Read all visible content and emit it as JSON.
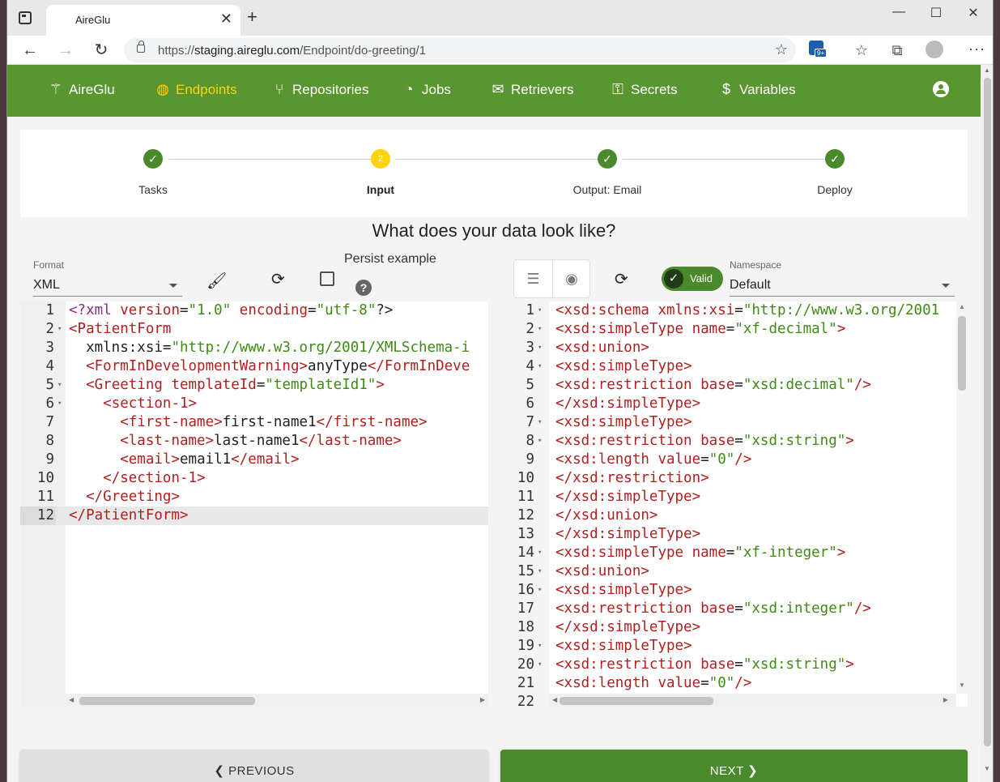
{
  "browser": {
    "tab_title": "AireGlu",
    "tab_close": "✕",
    "new_tab": "+",
    "minimize": "—",
    "maximize": "☐",
    "close": "✕",
    "url_prefix": "https://",
    "url_domain": "staging.aireglu.com",
    "url_path": "/Endpoint/do-greeting/1",
    "extension_badge": "9+"
  },
  "nav": {
    "brand": "AireGlu",
    "items": [
      {
        "label": "Endpoints",
        "icon": "globe-icon",
        "active": true
      },
      {
        "label": "Repositories",
        "icon": "branch-icon"
      },
      {
        "label": "Jobs",
        "icon": "clock-icon"
      },
      {
        "label": "Retrievers",
        "icon": "envelope-icon"
      },
      {
        "label": "Secrets",
        "icon": "key-icon"
      },
      {
        "label": "Variables",
        "icon": "dollar-icon"
      }
    ]
  },
  "stepper": {
    "steps": [
      {
        "label": "Tasks",
        "state": "done"
      },
      {
        "label": "Input",
        "state": "current",
        "number": "2"
      },
      {
        "label": "Output: Email",
        "state": "done"
      },
      {
        "label": "Deploy",
        "state": "done"
      }
    ]
  },
  "heading": "What does your data look like?",
  "left_toolbar": {
    "format_label": "Format",
    "format_value": "XML",
    "persist_label": "Persist example",
    "help": "?"
  },
  "right_toolbar": {
    "valid_label": "Valid",
    "namespace_label": "Namespace",
    "namespace_value": "Default"
  },
  "left_editor": {
    "lines": [
      "<?xml version=\"1.0\" encoding=\"utf-8\"?>",
      "<PatientForm",
      "  xmlns:xsi=\"http://www.w3.org/2001/XMLSchema-i",
      "  <FormInDevelopmentWarning>anyType</FormInDeve",
      "  <Greeting templateId=\"templateId1\">",
      "    <section-1>",
      "      <first-name>first-name1</first-name>",
      "      <last-name>last-name1</last-name>",
      "      <email>email1</email>",
      "    </section-1>",
      "  </Greeting>",
      "</PatientForm>"
    ]
  },
  "right_editor": {
    "lines": [
      "<xsd:schema xmlns:xsi=\"http://www.w3.org/2001",
      "<xsd:simpleType name=\"xf-decimal\">",
      "<xsd:union>",
      "<xsd:simpleType>",
      "<xsd:restriction base=\"xsd:decimal\"/>",
      "</xsd:simpleType>",
      "<xsd:simpleType>",
      "<xsd:restriction base=\"xsd:string\">",
      "<xsd:length value=\"0\"/>",
      "</xsd:restriction>",
      "</xsd:simpleType>",
      "</xsd:union>",
      "</xsd:simpleType>",
      "<xsd:simpleType name=\"xf-integer\">",
      "<xsd:union>",
      "<xsd:simpleType>",
      "<xsd:restriction base=\"xsd:integer\"/>",
      "</xsd:simpleType>",
      "<xsd:simpleType>",
      "<xsd:restriction base=\"xsd:string\">",
      "<xsd:length value=\"0\"/>",
      ""
    ]
  },
  "buttons": {
    "previous": "PREVIOUS",
    "next": "NEXT"
  }
}
